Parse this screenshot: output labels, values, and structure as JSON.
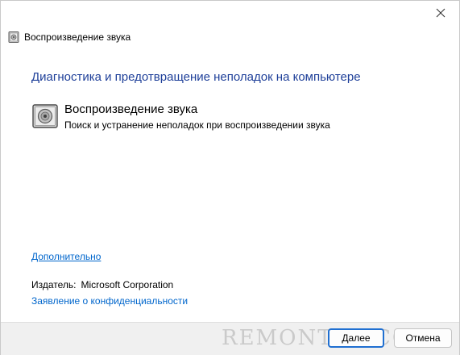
{
  "window": {
    "header_title": "Воспроизведение звука",
    "close_icon": "close-icon",
    "app_icon": "speaker-icon"
  },
  "main": {
    "heading": "Диагностика и предотвращение неполадок на компьютере",
    "task": {
      "title": "Воспроизведение звука",
      "description": "Поиск и устранение неполадок при воспроизведении звука",
      "icon": "speaker-icon"
    },
    "additional_link": "Дополнительно",
    "publisher_label": "Издатель:",
    "publisher_value": "Microsoft Corporation",
    "privacy_link": "Заявление о конфиденциальности"
  },
  "footer": {
    "next_label": "Далее",
    "cancel_label": "Отмена",
    "watermark": "REMONTKA.COM"
  },
  "colors": {
    "heading": "#1e3f99",
    "link": "#0066cc",
    "footer_bg": "#f0f0f0",
    "default_button_border": "#1f6fd1"
  }
}
